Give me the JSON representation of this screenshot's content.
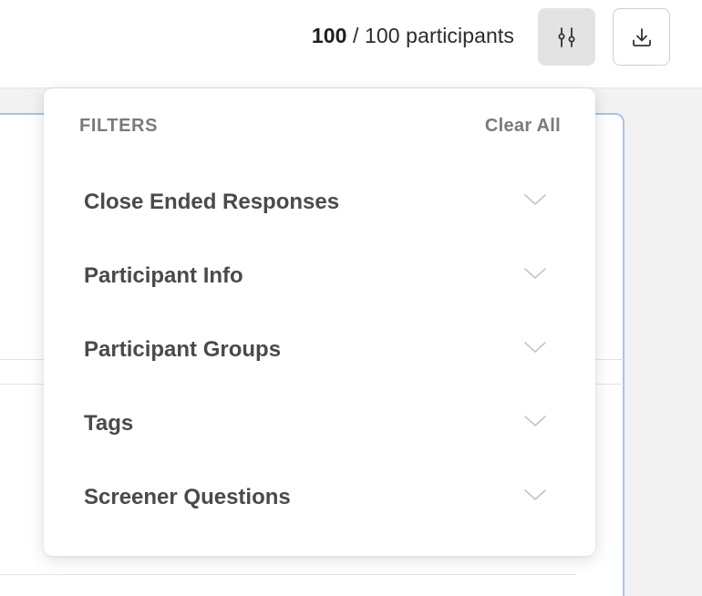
{
  "header": {
    "filtered_count": "100",
    "total_label": " / 100 participants",
    "filter_icon": "sliders-icon",
    "download_icon": "download-icon"
  },
  "filters": {
    "title": "FILTERS",
    "clear_label": "Clear All",
    "sections": [
      {
        "label": "Close Ended Responses"
      },
      {
        "label": "Participant Info"
      },
      {
        "label": "Participant Groups"
      },
      {
        "label": "Tags"
      },
      {
        "label": "Screener Questions"
      }
    ],
    "chevron_icon": "chevron-down-icon"
  },
  "colors": {
    "accent_border": "#a9c1ea",
    "muted_text": "#7a7a7a",
    "label_text": "#4a4a4a"
  }
}
